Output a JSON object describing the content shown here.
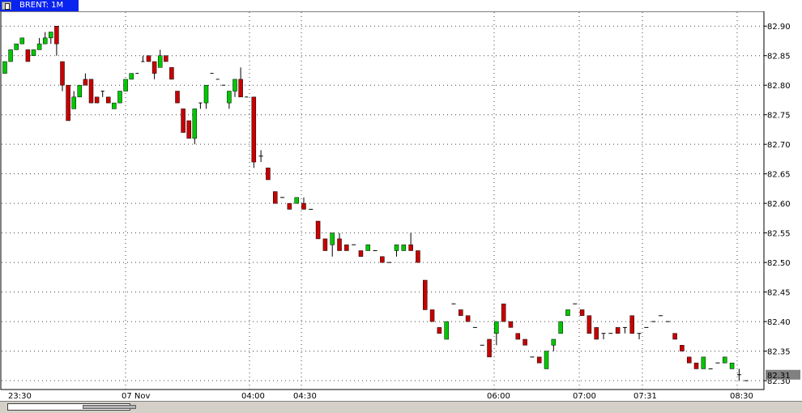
{
  "window": {
    "title": "BRENT: 1M",
    "icon": "window-icon"
  },
  "chart_data": {
    "type": "candlestick",
    "instrument": "BRENT",
    "timeframe": "1M",
    "ylim": [
      82.285,
      82.925
    ],
    "grid": true,
    "y_ticks": [
      "82.90",
      "82.85",
      "82.80",
      "82.75",
      "82.70",
      "82.65",
      "82.60",
      "82.55",
      "82.50",
      "82.45",
      "82.40",
      "82.35",
      "82.30"
    ],
    "x_labels": [
      "23:30",
      "07 Nov",
      "04:00",
      "04:30",
      "06:00",
      "07:00",
      "07:31",
      "08:30"
    ],
    "last_price": "82.31",
    "colors": {
      "up": "#00c800",
      "down": "#c80000",
      "grid": "#404040",
      "tag_bg": "#808080"
    },
    "candles": [
      [
        82.82,
        82.84,
        82.82,
        82.84
      ],
      [
        82.84,
        82.86,
        82.84,
        82.86
      ],
      [
        82.86,
        82.87,
        82.86,
        82.87
      ],
      [
        82.87,
        82.88,
        82.87,
        82.88
      ],
      [
        82.86,
        82.86,
        82.84,
        82.84
      ],
      [
        82.85,
        82.86,
        82.85,
        82.86
      ],
      [
        82.86,
        82.88,
        82.86,
        82.87
      ],
      [
        82.87,
        82.89,
        82.87,
        82.88
      ],
      [
        82.88,
        82.89,
        82.87,
        82.89
      ],
      [
        82.9,
        82.9,
        82.85,
        82.87
      ],
      [
        82.84,
        82.84,
        82.79,
        82.8
      ],
      [
        82.8,
        82.8,
        82.74,
        82.74
      ],
      [
        82.76,
        82.79,
        82.76,
        82.78
      ],
      [
        82.78,
        82.8,
        82.78,
        82.8
      ],
      [
        82.81,
        82.82,
        82.81,
        82.8
      ],
      [
        82.81,
        82.81,
        82.77,
        82.77
      ],
      [
        82.78,
        82.78,
        82.77,
        82.77
      ],
      [
        82.79,
        82.79,
        82.78,
        82.79
      ],
      [
        82.78,
        82.78,
        82.77,
        82.77
      ],
      [
        82.76,
        82.76,
        82.76,
        82.77
      ],
      [
        82.77,
        82.79,
        82.77,
        82.79
      ],
      [
        82.79,
        82.81,
        82.79,
        82.81
      ],
      [
        82.81,
        82.82,
        82.81,
        82.82
      ],
      [
        82.82,
        82.82,
        82.82,
        82.82
      ],
      [
        82.84,
        82.85,
        82.84,
        82.84
      ],
      [
        82.85,
        82.85,
        82.84,
        82.84
      ],
      [
        82.84,
        82.84,
        82.81,
        82.82
      ],
      [
        82.83,
        82.86,
        82.83,
        82.85
      ],
      [
        82.85,
        82.85,
        82.84,
        82.84
      ],
      [
        82.83,
        82.83,
        82.81,
        82.81
      ],
      [
        82.79,
        82.79,
        82.77,
        82.77
      ],
      [
        82.76,
        82.76,
        82.72,
        82.72
      ],
      [
        82.74,
        82.74,
        82.71,
        82.71
      ],
      [
        82.71,
        82.71,
        82.7,
        82.76
      ],
      [
        82.77,
        82.77,
        82.76,
        82.77
      ],
      [
        82.77,
        82.77,
        82.76,
        82.8
      ],
      [
        82.82,
        82.82,
        82.82,
        82.82
      ],
      [
        82.81,
        82.81,
        82.81,
        82.81
      ],
      [
        82.8,
        82.8,
        82.8,
        82.8
      ],
      [
        82.77,
        82.77,
        82.76,
        82.79
      ],
      [
        82.79,
        82.79,
        82.78,
        82.81
      ],
      [
        82.81,
        82.83,
        82.81,
        82.78
      ],
      [
        82.78,
        82.78,
        82.78,
        82.78
      ]
    ]
  }
}
